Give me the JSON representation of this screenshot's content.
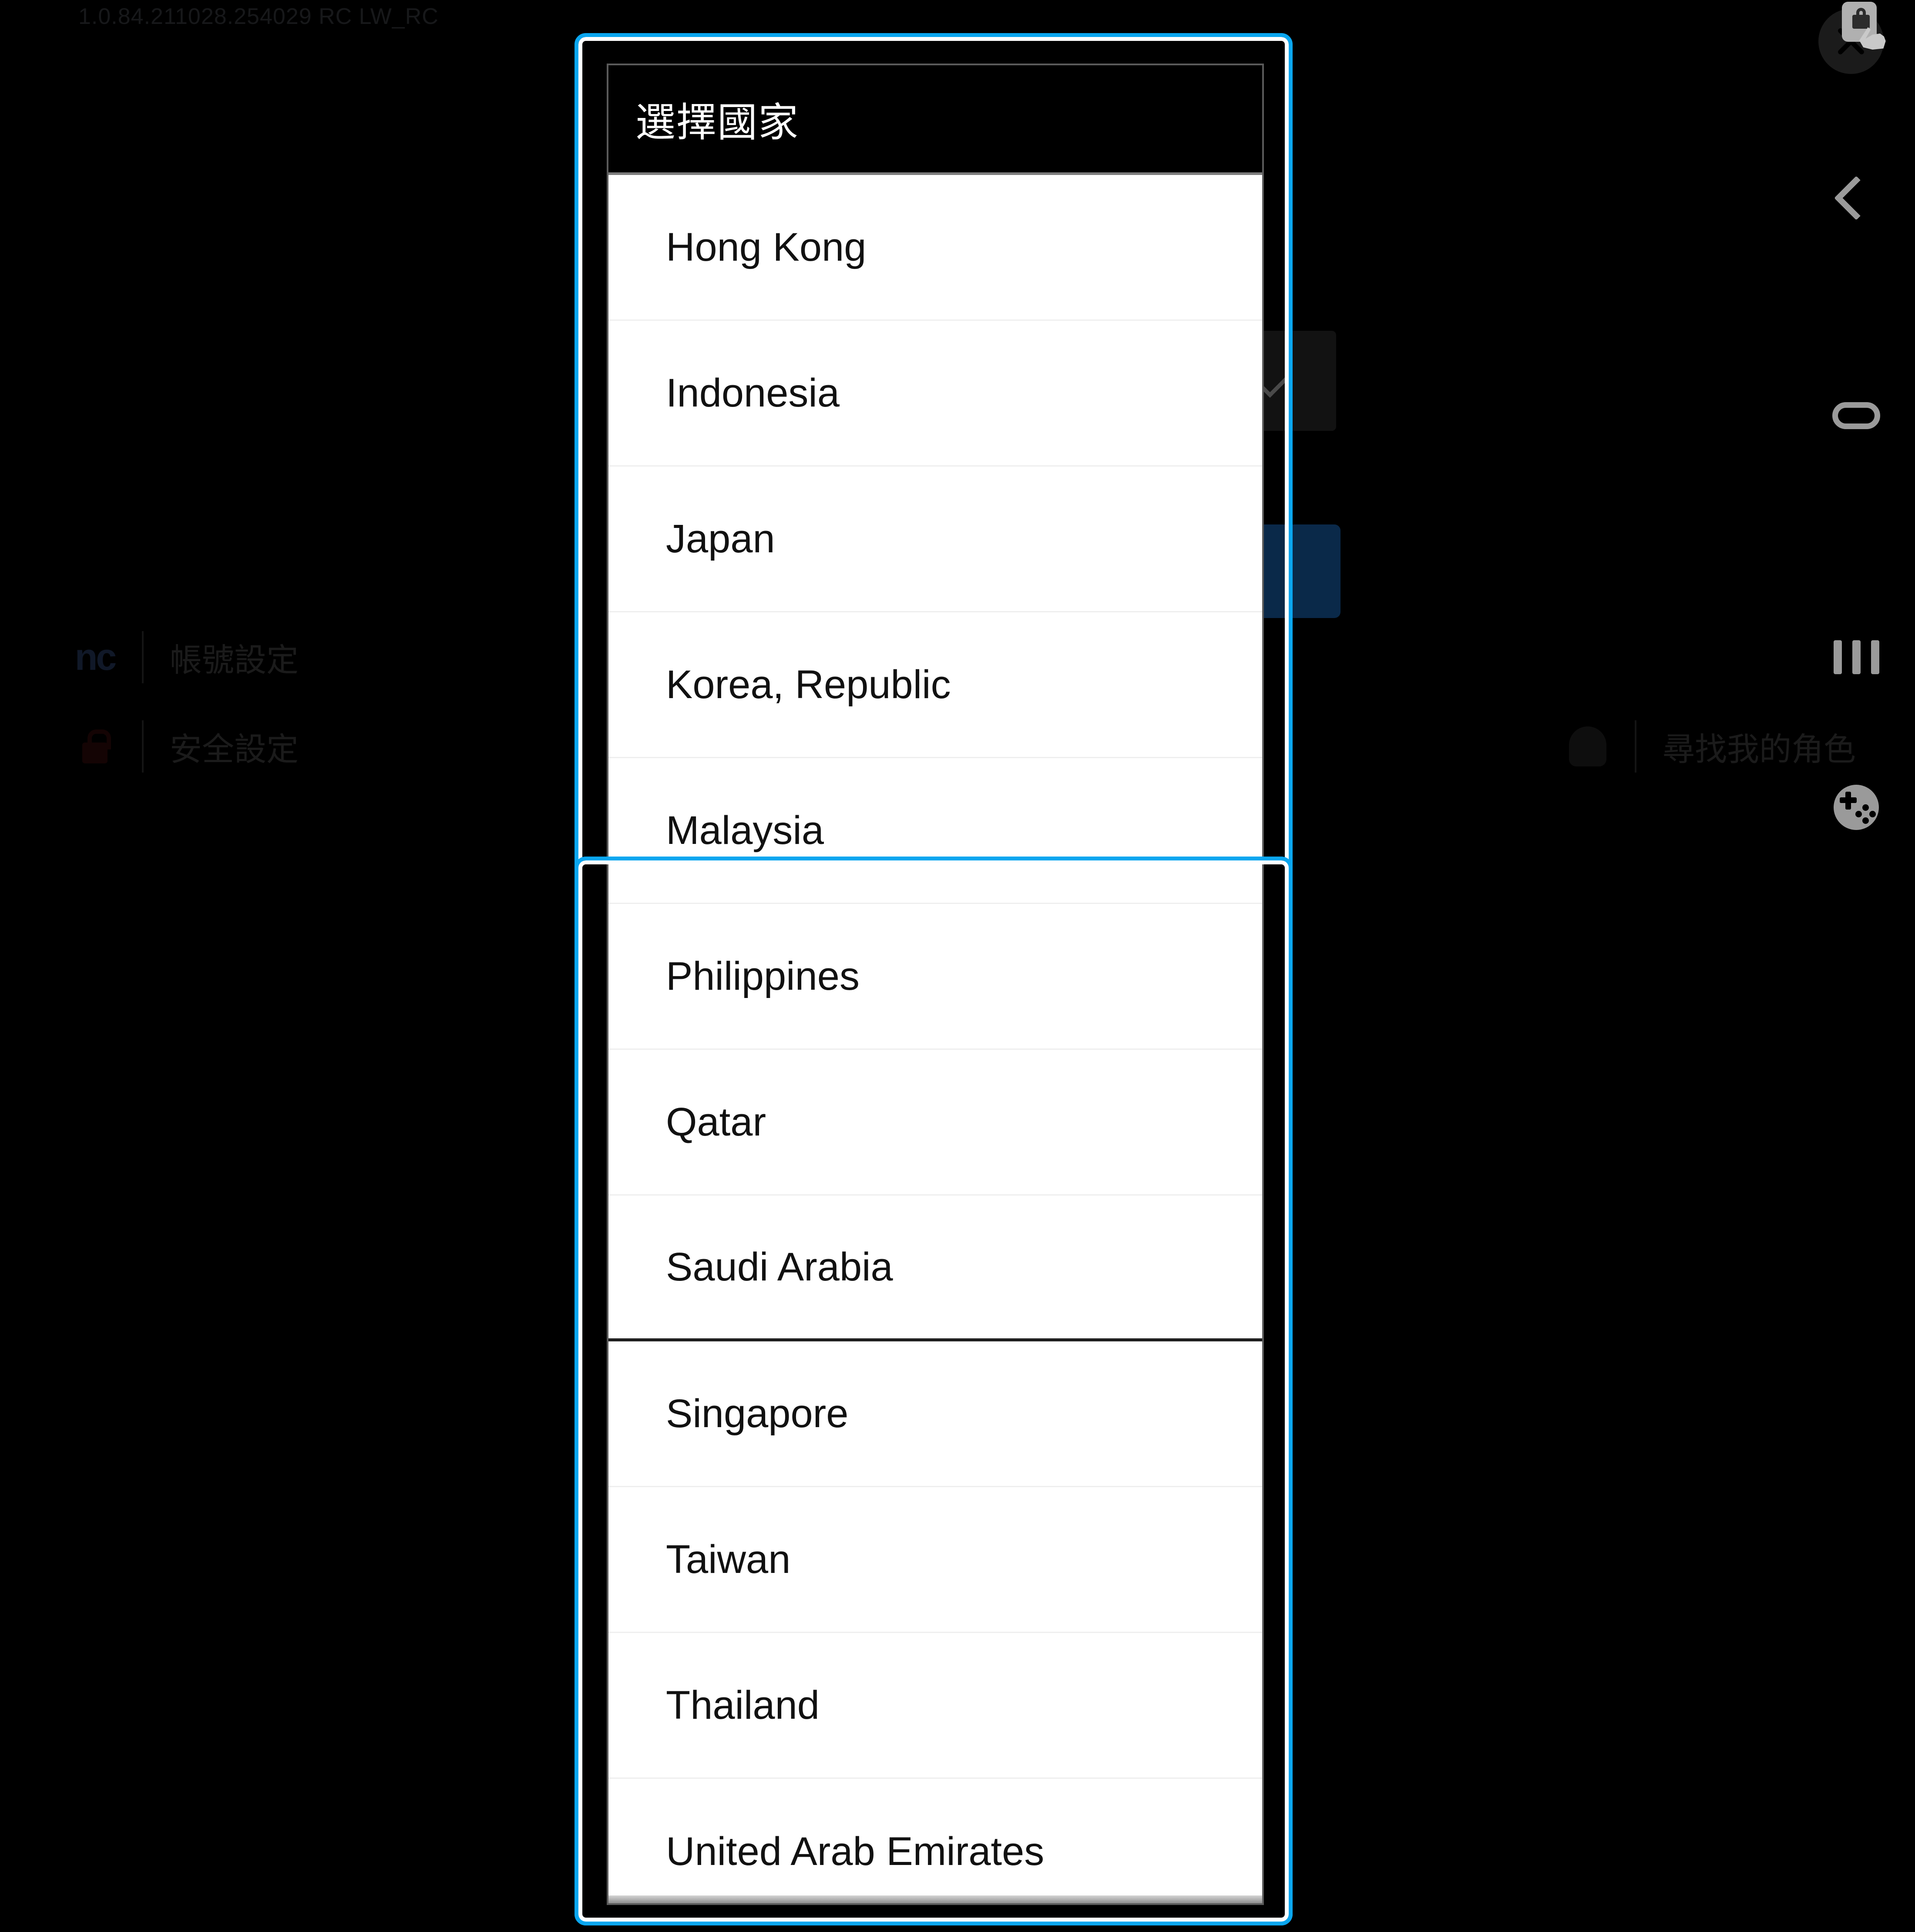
{
  "background": {
    "version_text": "1.0.84.211028.254029 RC LW_RC",
    "menu_items": [
      {
        "id": "account-settings",
        "label": "帳號設定",
        "icon": "nc-logo-icon"
      },
      {
        "id": "security-settings",
        "label": "安全設定",
        "icon": "lock-icon"
      },
      {
        "id": "find-my-character",
        "label": "尋找我的角色",
        "icon": "character-bust-icon"
      }
    ],
    "dropdown": {
      "icon": "chevron-down-icon"
    },
    "primary_button": {
      "label": "",
      "color": "#0a2949"
    }
  },
  "nav_rail": {
    "items": [
      {
        "id": "close",
        "icon": "close-x-icon",
        "overlay_icon": "touch-lock-icon"
      },
      {
        "id": "back",
        "icon": "chevron-left-icon"
      },
      {
        "id": "home",
        "icon": "home-pill-icon"
      },
      {
        "id": "recents",
        "icon": "three-bars-icon"
      },
      {
        "id": "game-center",
        "icon": "gamepad-icon"
      }
    ]
  },
  "dialog": {
    "title": "選擇國家",
    "countries": [
      {
        "name": "Hong Kong",
        "section_end": false
      },
      {
        "name": "Indonesia",
        "section_end": false
      },
      {
        "name": "Japan",
        "section_end": false
      },
      {
        "name": "Korea, Republic",
        "section_end": false
      },
      {
        "name": "Malaysia",
        "section_end": false
      },
      {
        "name": "Philippines",
        "section_end": false
      },
      {
        "name": "Qatar",
        "section_end": false
      },
      {
        "name": "Saudi Arabia",
        "section_end": true
      },
      {
        "name": "Singapore",
        "section_end": false
      },
      {
        "name": "Taiwan",
        "section_end": false
      },
      {
        "name": "Thailand",
        "section_end": false
      },
      {
        "name": "United Arab Emirates",
        "section_end": false
      }
    ]
  },
  "highlight": {
    "accent_color": "#0aa6ef",
    "inner_color": "#ffffff"
  }
}
